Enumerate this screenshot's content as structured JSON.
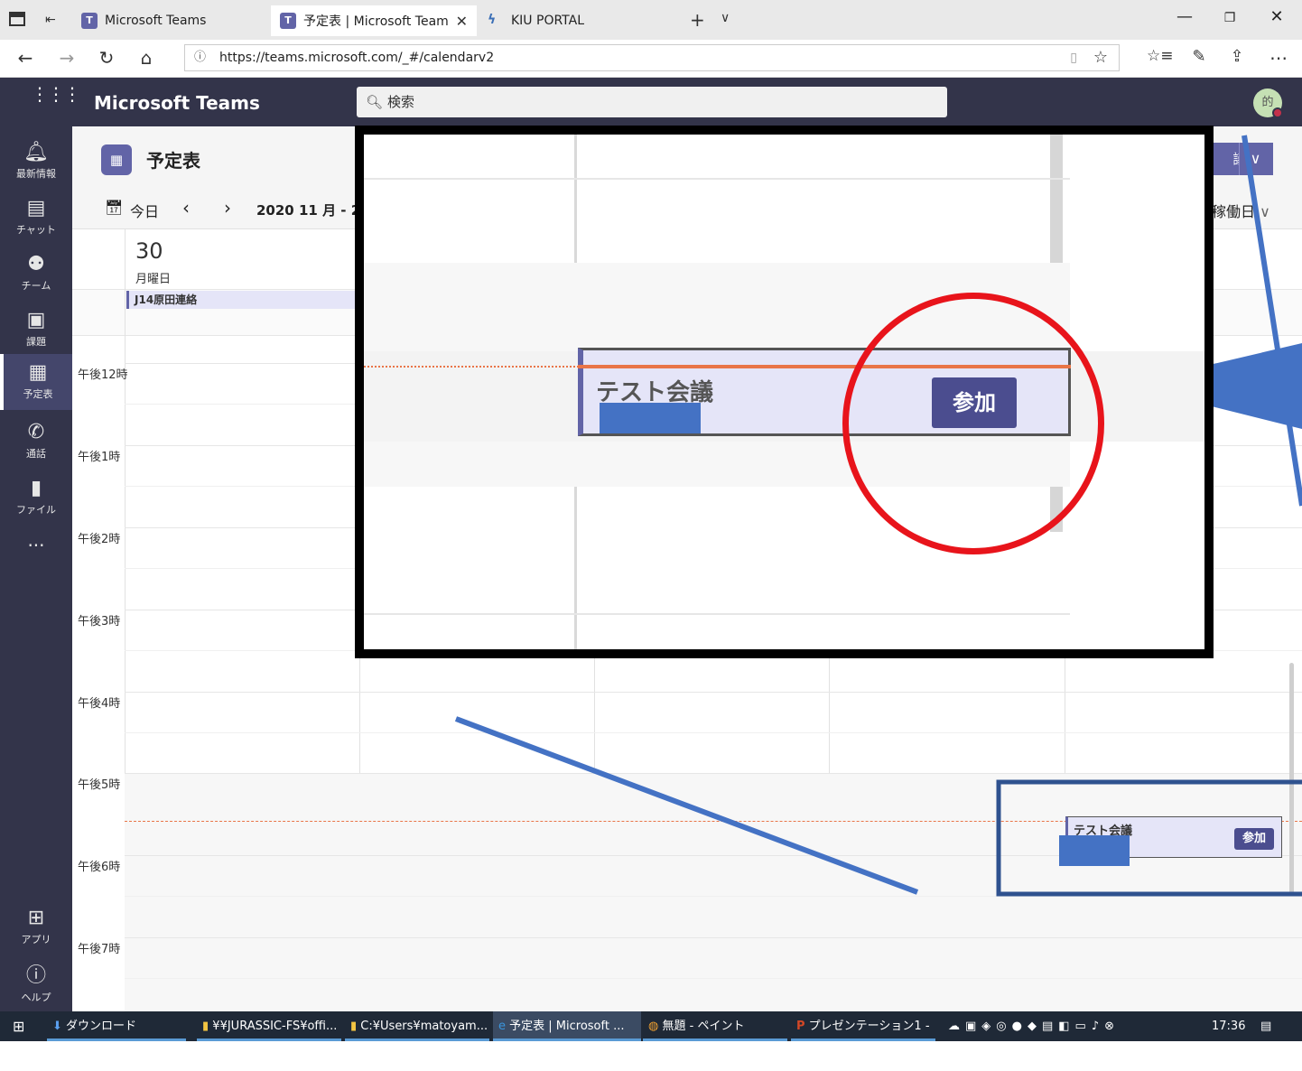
{
  "browser": {
    "tabs": [
      {
        "label": "Microsoft Teams"
      },
      {
        "label": "予定表 | Microsoft Team"
      },
      {
        "label": "KIU PORTAL"
      }
    ],
    "url": "https://teams.microsoft.com/_#/calendarv2"
  },
  "teams": {
    "title": "Microsoft Teams",
    "search_placeholder": "検索",
    "avatar_initial": "的"
  },
  "rail": {
    "items": [
      {
        "label": "最新情報"
      },
      {
        "label": "チャット"
      },
      {
        "label": "チーム"
      },
      {
        "label": "課題"
      },
      {
        "label": "予定表"
      },
      {
        "label": "通話"
      },
      {
        "label": "ファイル"
      },
      {
        "label": "..."
      }
    ],
    "bottom": [
      {
        "label": "アプリ"
      },
      {
        "label": "ヘルプ"
      }
    ]
  },
  "calendar": {
    "title": "予定表",
    "today_label": "今日",
    "range_label": "2020 11 月 - 20",
    "view_label": "稼働日",
    "new_meeting_partial": "議",
    "day": {
      "number": "30",
      "weekday": "月曜日"
    },
    "allday_event": "J14原田連絡",
    "times": [
      "午後12時",
      "午後1時",
      "午後2時",
      "午後3時",
      "午後4時",
      "午後5時",
      "午後6時",
      "午後7時"
    ],
    "event": {
      "title": "テスト会議",
      "join_label": "参加"
    }
  },
  "annotation": {
    "zoom_event_title": "テスト会議",
    "zoom_join_label": "参加"
  },
  "taskbar": {
    "items": [
      {
        "label": "ダウンロード"
      },
      {
        "label": "¥¥JURASSIC-FS¥offi..."
      },
      {
        "label": "C:¥Users¥matoyam..."
      },
      {
        "label": "予定表 | Microsoft ..."
      },
      {
        "label": "無題 - ペイント"
      },
      {
        "label": "プレゼンテーション1 - ..."
      }
    ],
    "clock": "17:36"
  },
  "colors": {
    "teams_purple": "#6264a7",
    "teams_dark": "#33344a",
    "annotation_red": "#e8141b",
    "annotation_blue": "#4472c4",
    "now_line": "#e97548"
  }
}
